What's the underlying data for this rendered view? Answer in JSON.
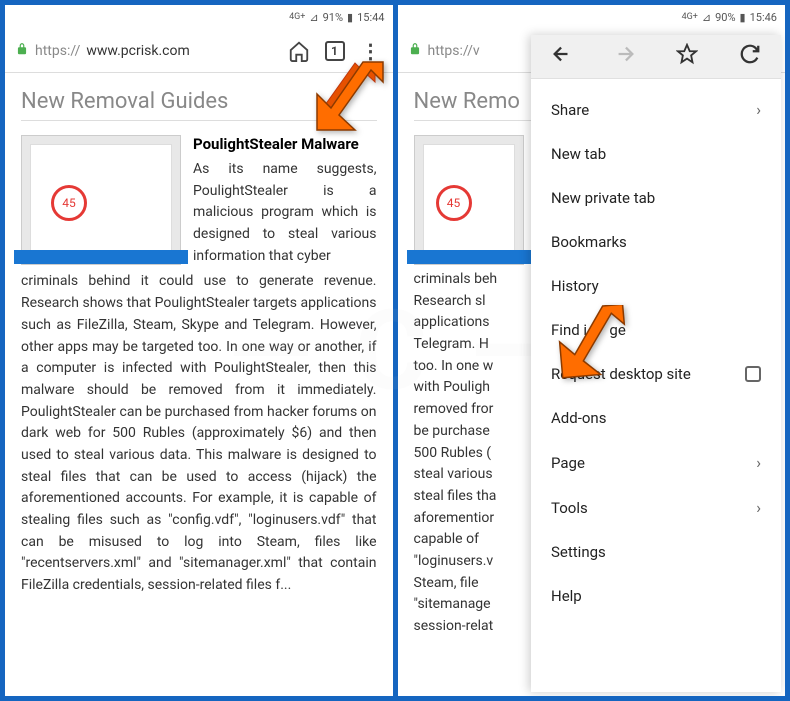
{
  "left": {
    "status": {
      "network": "4G+",
      "signal": "⊿",
      "battery_pct": "91%",
      "battery_icon": "▮",
      "time": "15:44"
    },
    "url_protocol": "https://",
    "url_host": "www.pcrisk.com",
    "tab_count": "1",
    "section_title": "New Removal Guides",
    "article_title": "PoulightStealer Malware",
    "thumb_num": "45",
    "article_lead": "As its name suggests, PoulightStealer is a malicious program which is designed to steal various information that cyber",
    "article_body": "criminals behind it could use to generate revenue. Research shows that PoulightStealer targets applications such as FileZilla, Steam, Skype and Telegram. However, other apps may be targeted too. In one way or another, if a computer is infected with PoulightStealer, then this malware should be removed from it immediately. PoulightStealer can be purchased from hacker forums on dark web for 500 Rubles (approximately $6) and then used to steal various data. This malware is designed to steal files that can be used to access (hijack) the aforementioned accounts. For example, it is capable of stealing files such as \"config.vdf\", \"loginusers.vdf\" that can be misused to log into Steam, files like \"recentservers.xml\" and \"sitemanager.xml\" that contain FileZilla credentials, session-related files f..."
  },
  "right": {
    "status": {
      "network": "4G+",
      "signal": "⊿",
      "battery_pct": "90%",
      "battery_icon": "▮",
      "time": "15:46"
    },
    "url_prefix": "https://v",
    "section_title": "New Remo",
    "thumb_num": "45",
    "article_body": "criminals beh\nResearch sl\napplications\nTelegram. H\ntoo. In one w\nwith Pouligh\nremoved fror\nbe purchase\n500 Rubles (\nsteal various\nsteal files tha\naforementior\ncapable of\n\"loginusers.v\nSteam, file\n\"sitemanage\nsession-relat",
    "menu": {
      "share": "Share",
      "new_tab": "New tab",
      "new_private": "New private tab",
      "bookmarks": "Bookmarks",
      "history": "History",
      "find": "Find i",
      "find_suffix": "ge",
      "request_desktop": "Request desktop site",
      "addons": "Add-ons",
      "page": "Page",
      "tools": "Tools",
      "settings": "Settings",
      "help": "Help"
    }
  }
}
